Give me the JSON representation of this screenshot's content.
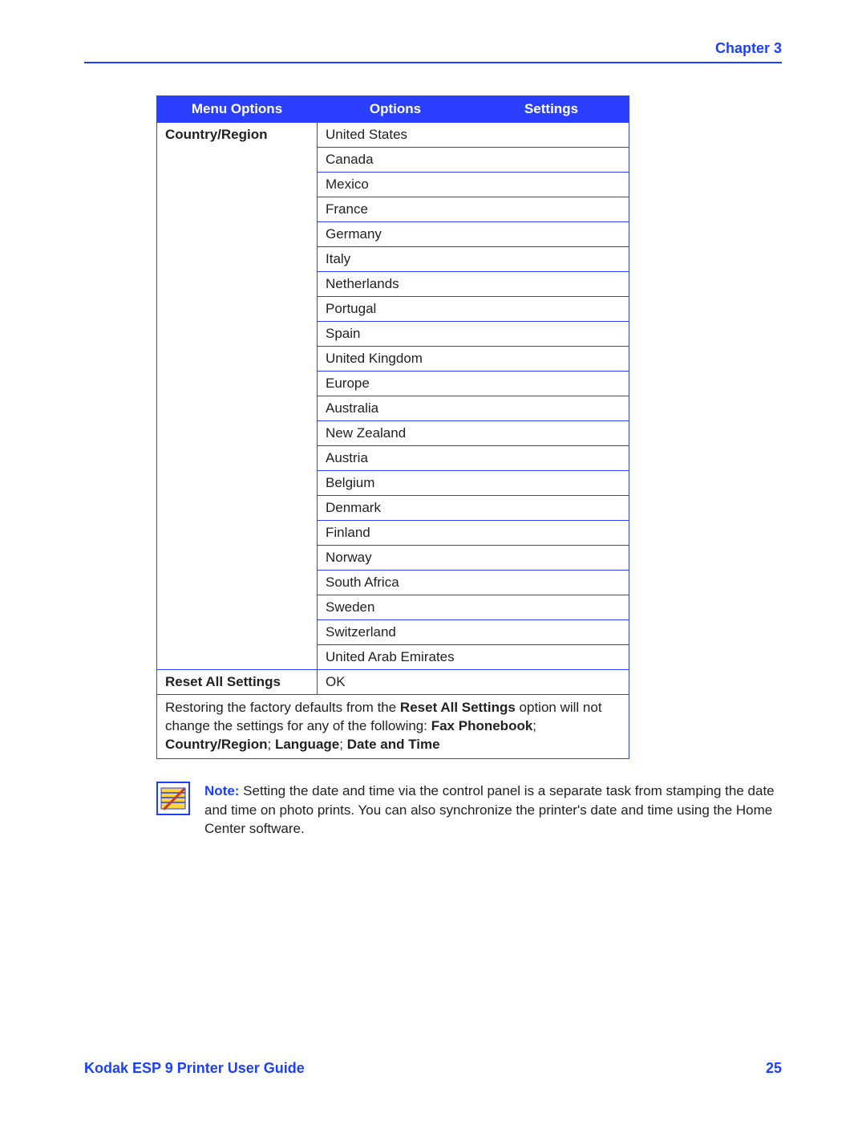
{
  "header": {
    "chapter_label": "Chapter 3"
  },
  "table": {
    "headers": [
      "Menu Options",
      "Options",
      "Settings"
    ],
    "rows": [
      {
        "menu": "Country/Region",
        "option": "United States"
      },
      {
        "option": "Canada"
      },
      {
        "option": "Mexico"
      },
      {
        "option": "France"
      },
      {
        "option": "Germany"
      },
      {
        "option": "Italy"
      },
      {
        "option": "Netherlands"
      },
      {
        "option": "Portugal"
      },
      {
        "option": "Spain"
      },
      {
        "option": "United Kingdom"
      },
      {
        "option": "Europe"
      },
      {
        "option": "Australia"
      },
      {
        "option": "New Zealand"
      },
      {
        "option": "Austria"
      },
      {
        "option": "Belgium"
      },
      {
        "option": "Denmark"
      },
      {
        "option": "Finland"
      },
      {
        "option": "Norway"
      },
      {
        "option": "South Africa"
      },
      {
        "option": "Sweden"
      },
      {
        "option": "Switzerland"
      },
      {
        "option": "United Arab Emirates"
      },
      {
        "menu": "Reset All Settings",
        "option": "OK"
      }
    ],
    "footnote": {
      "pre": "Restoring the factory defaults from the ",
      "b1": "Reset All Settings",
      "mid1": " option will not change the settings for any of the following: ",
      "b2": "Fax Phonebook",
      "sep1": "; ",
      "b3": "Country/Region",
      "sep2": "; ",
      "b4": "Language",
      "sep3": "; ",
      "b5": "Date and Time"
    }
  },
  "note": {
    "label": "Note:",
    "text": "  Setting the date and time via the control panel is a separate task from stamping the date and time on photo prints. You can also synchronize the printer's date and time using the Home Center software."
  },
  "footer": {
    "title": "Kodak ESP 9 Printer User Guide",
    "page": "25"
  }
}
